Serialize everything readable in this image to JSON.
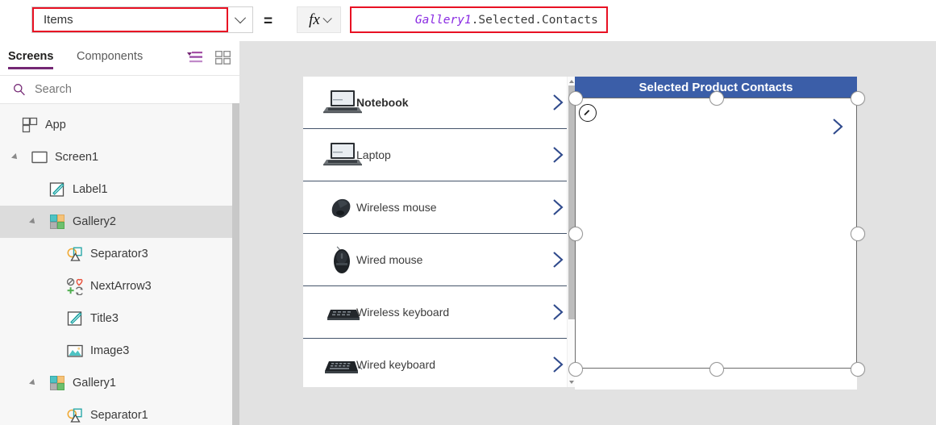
{
  "formula_bar": {
    "property_value": "Items",
    "property_dropdown_icon": "chevron-down-icon",
    "equals_sign": "=",
    "fx_label": "fx",
    "fx_dropdown_icon": "chevron-down-icon",
    "formula_control_token": "Gallery1",
    "formula_rest_token": ".Selected.Contacts",
    "highlight_color": "#e81123"
  },
  "left_panel": {
    "tabs": [
      {
        "label": "Screens",
        "active": true
      },
      {
        "label": "Components",
        "active": false
      }
    ],
    "tree_view_icon": "tree-list-icon",
    "thumbnail_view_icon": "grid-view-icon",
    "search": {
      "icon": "search-icon",
      "placeholder": "Search",
      "value": ""
    },
    "tree": [
      {
        "label": "App",
        "icon": "app-icon",
        "indent": 26,
        "twisty": false,
        "selected": false
      },
      {
        "label": "Screen1",
        "icon": "screen-icon",
        "indent": 38,
        "twisty": true,
        "selected": false
      },
      {
        "label": "Label1",
        "icon": "label-icon",
        "indent": 60,
        "twisty": false,
        "selected": false
      },
      {
        "label": "Gallery2",
        "icon": "gallery-icon",
        "indent": 60,
        "twisty": true,
        "selected": true
      },
      {
        "label": "Separator3",
        "icon": "separator-icon",
        "indent": 82,
        "twisty": false,
        "selected": false
      },
      {
        "label": "NextArrow3",
        "icon": "icon-set-icon",
        "indent": 82,
        "twisty": false,
        "selected": false
      },
      {
        "label": "Title3",
        "icon": "label-icon",
        "indent": 82,
        "twisty": false,
        "selected": false
      },
      {
        "label": "Image3",
        "icon": "image-icon",
        "indent": 82,
        "twisty": false,
        "selected": false
      },
      {
        "label": "Gallery1",
        "icon": "gallery-icon",
        "indent": 60,
        "twisty": true,
        "selected": false
      },
      {
        "label": "Separator1",
        "icon": "separator-icon",
        "indent": 82,
        "twisty": false,
        "selected": false
      }
    ]
  },
  "canvas": {
    "product_gallery": {
      "name": "Gallery1",
      "items": [
        {
          "title": "Notebook",
          "thumb": "notebook-thumbnail",
          "selected": true
        },
        {
          "title": "Laptop",
          "thumb": "laptop-thumbnail",
          "selected": false
        },
        {
          "title": "Wireless mouse",
          "thumb": "wireless-mouse-thumbnail",
          "selected": false
        },
        {
          "title": "Wired mouse",
          "thumb": "wired-mouse-thumbnail",
          "selected": false
        },
        {
          "title": "Wireless keyboard",
          "thumb": "wireless-keyboard-thumbnail",
          "selected": false
        },
        {
          "title": "Wired keyboard",
          "thumb": "wired-keyboard-thumbnail",
          "selected": false
        }
      ],
      "next_arrow_icon": "chevron-right-icon",
      "scrollbar": {
        "up_icon": "scroll-up-arrow-icon",
        "down_icon": "scroll-down-arrow-icon"
      }
    },
    "selected_gallery": {
      "name": "Gallery2",
      "header_title": "Selected Product Contacts",
      "header_color": "#3b5ea8",
      "next_arrow_icon": "chevron-right-icon",
      "edit_badge_icon": "pencil-edit-icon",
      "selected": true
    }
  }
}
